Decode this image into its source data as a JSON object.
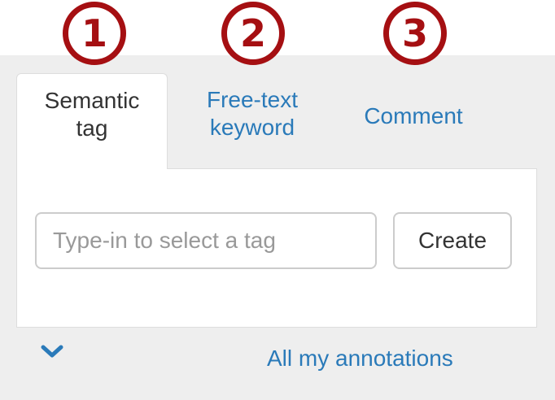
{
  "badges": [
    "1",
    "2",
    "3"
  ],
  "tabs": [
    {
      "line1": "Semantic",
      "line2": "tag",
      "active": true
    },
    {
      "line1": "Free-text",
      "line2": "keyword",
      "active": false
    },
    {
      "line1": "Comment",
      "active": false
    }
  ],
  "tag_input": {
    "placeholder": "Type-in to select a tag",
    "value": ""
  },
  "create_button": {
    "label": "Create"
  },
  "footer": {
    "expand_icon": "chevron-down-icon",
    "all_annotations_link": "All my annotations"
  },
  "colors": {
    "badge": "#a50f12",
    "link": "#2a7ab9",
    "panel_bg": "#eeeeee",
    "border": "#dddddd"
  }
}
